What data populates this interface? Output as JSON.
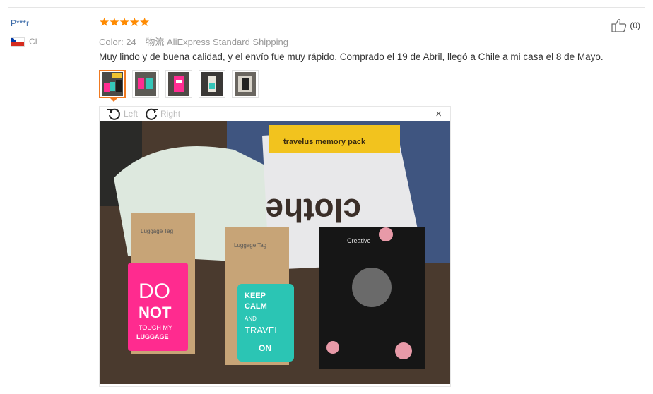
{
  "reviewer": {
    "name": "P***r",
    "country": "CL"
  },
  "review": {
    "stars": "★★★★★",
    "color_label": "Color: 24",
    "shipping_label": "物流",
    "shipping_method": "AliExpress Standard Shipping",
    "text": "Muy lindo y de buena calidad, y el envío fue muy rápido. Comprado el 19 de Abril, llegó a Chile a mi casa el 8 de Mayo."
  },
  "helpful": {
    "count": "(0)"
  },
  "thumbnails": {
    "count": 5,
    "active_index": 0
  },
  "viewer": {
    "rotate_left": "Left",
    "rotate_right": "Right",
    "close": "×",
    "photo_texts": {
      "pack_brand": "travelus memory pack",
      "bag_text": "clothe",
      "tag_label": "Luggage Tag",
      "pink_tag_line1": "DO",
      "pink_tag_line2": "NOT",
      "pink_tag_line3": "TOUCH MY",
      "pink_tag_line4": "LUGGAGE",
      "teal_tag_line1": "KEEP",
      "teal_tag_line2": "CALM",
      "teal_tag_line3": "AND",
      "teal_tag_line4": "TRAVEL",
      "teal_tag_line5": "ON",
      "passport_label": "Creative"
    }
  }
}
